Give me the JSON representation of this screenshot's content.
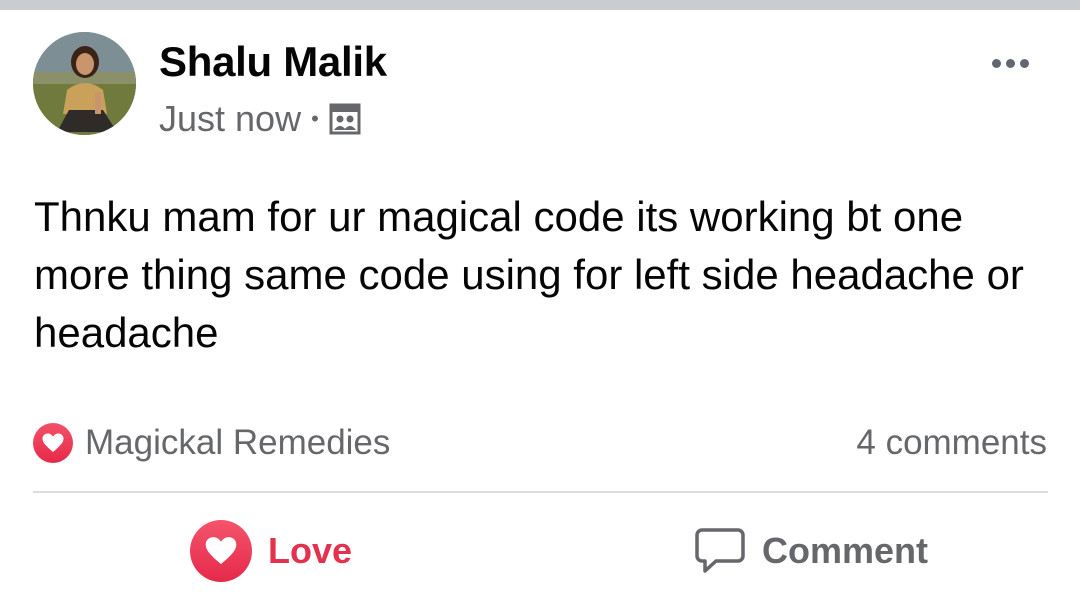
{
  "post": {
    "author": "Shalu Malik",
    "timestamp": "Just now",
    "separator": "•",
    "audience_icon": "group-icon",
    "body": "Thnku mam for ur magical code its working bt one more thing same code using for left side headache or headache"
  },
  "reactions": {
    "icon": "love-reaction-icon",
    "label": "Magickal Remedies"
  },
  "comments": {
    "count_label": "4 comments"
  },
  "actions": {
    "love_label": "Love",
    "comment_label": "Comment"
  },
  "colors": {
    "love_accent": "#e4314e",
    "secondary_text": "#65676b",
    "primary_text": "#050505",
    "divider": "#dadde1"
  }
}
